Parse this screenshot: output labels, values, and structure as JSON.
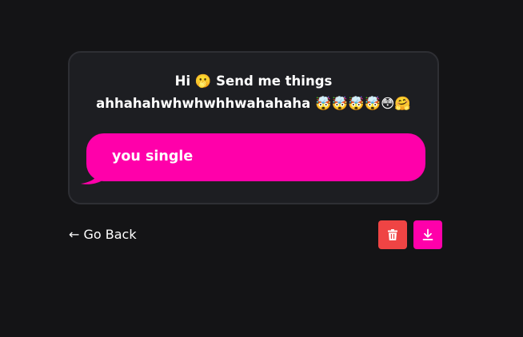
{
  "prompt": {
    "line1": "Hi 🫢 Send me things",
    "line2": "ahhahahwhwhwhhwahahaha 🤯🤯🤯🤯😳🤗"
  },
  "message": {
    "text": "you single"
  },
  "nav": {
    "back_label": "← Go Back"
  },
  "actions": {
    "delete_icon": "trash-icon",
    "download_icon": "download-icon"
  },
  "colors": {
    "background": "#141416",
    "card": "#1d1e22",
    "accent_pink": "#ff00aa",
    "delete_red": "#ef4444"
  }
}
